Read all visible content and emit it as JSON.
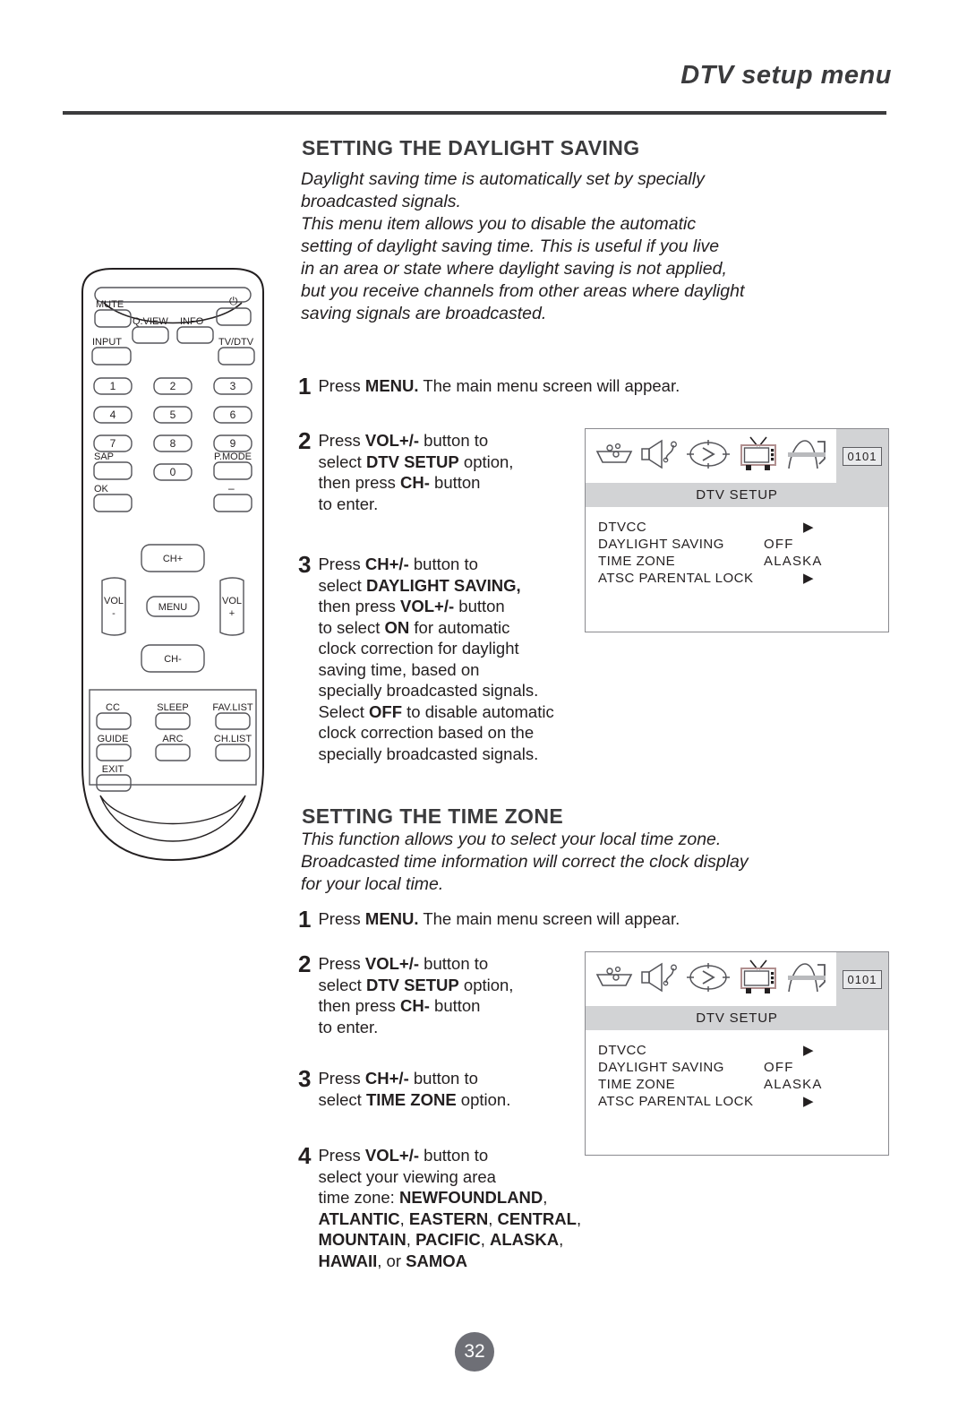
{
  "header": {
    "title": "DTV setup menu"
  },
  "sections": [
    {
      "title": "SETTING THE DAYLIGHT SAVING",
      "body": "Daylight saving time is automatically set by specially\nbroadcasted signals.\nThis menu item allows you to disable the automatic\nsetting of daylight saving time. This is useful if you live\nin an area or state where daylight saving is not applied,\nbut you receive channels from other areas where daylight\nsaving signals are broadcasted."
    },
    {
      "title": "SETTING THE TIME ZONE",
      "body": "This function allows you to select your local time zone.\nBroadcasted time information will correct the clock display\nfor your local time."
    }
  ],
  "steps_daylight": [
    {
      "num": "1",
      "html": "Press <b>MENU.</b> The main menu screen will appear."
    },
    {
      "num": "2",
      "html": "Press <b>VOL+/-</b> button to\nselect <b>DTV SETUP</b> option,\nthen press <b>CH-</b> button\nto enter."
    },
    {
      "num": "3",
      "html": "Press <b>CH+/-</b> button to\nselect <b>DAYLIGHT SAVING,</b>\nthen press <b>VOL+/-</b> button\nto select <b>ON</b> for automatic\nclock correction for daylight\nsaving time, based on\nspecially broadcasted signals.\nSelect <b>OFF</b> to disable automatic\nclock correction based on the\nspecially broadcasted signals."
    }
  ],
  "steps_timezone": [
    {
      "num": "1",
      "html": "Press <b>MENU.</b> The main menu screen will appear."
    },
    {
      "num": "2",
      "html": "Press <b>VOL+/-</b> button to\nselect <b>DTV SETUP</b> option,\nthen press <b>CH-</b> button\nto enter."
    },
    {
      "num": "3",
      "html": "Press <b>CH+/-</b> button to\nselect <b>TIME ZONE</b> option."
    },
    {
      "num": "4",
      "html": "Press <b>VOL+/-</b> button to\nselect your viewing area\ntime zone: <b>NEWFOUNDLAND</b>,\n<b>ATLANTIC</b>, <b>EASTERN</b>, <b>CENTRAL</b>,\n<b>MOUNTAIN</b>, <b>PACIFIC</b>, <b>ALASKA</b>,\n<b>HAWAII</b>, or <b>SAMOA</b>"
    }
  ],
  "osd": {
    "channel_number": "0101",
    "menu_title": "DTV SETUP",
    "icons": [
      "picture-icon",
      "sound-icon",
      "timer-icon",
      "tv-setup-icon",
      "lock-icon"
    ],
    "rows": [
      {
        "label": "DTVCC",
        "value": "",
        "arrow": "▶"
      },
      {
        "label": "DAYLIGHT SAVING",
        "value": "OFF",
        "arrow": ""
      },
      {
        "label": "TIME ZONE",
        "value": "ALASKA",
        "arrow": ""
      },
      {
        "label": "ATSC PARENTAL LOCK",
        "value": "",
        "arrow": "▶"
      }
    ]
  },
  "remote": {
    "top_row": [
      {
        "label": "MUTE",
        "name": "mute-button"
      },
      {
        "label": "Q.VIEW",
        "name": "qview-button"
      },
      {
        "label": "INFO",
        "name": "info-button"
      },
      {
        "label": "⏻",
        "name": "power-button"
      }
    ],
    "second_row": [
      {
        "label": "INPUT",
        "name": "input-button"
      },
      {
        "label": "TV/DTV",
        "name": "tv-dtv-button"
      }
    ],
    "numeric": [
      {
        "label": "1",
        "name": "digit-1-button"
      },
      {
        "label": "2",
        "name": "digit-2-button"
      },
      {
        "label": "3",
        "name": "digit-3-button"
      },
      {
        "label": "4",
        "name": "digit-4-button"
      },
      {
        "label": "5",
        "name": "digit-5-button"
      },
      {
        "label": "6",
        "name": "digit-6-button"
      },
      {
        "label": "7",
        "name": "digit-7-button"
      },
      {
        "label": "8",
        "name": "digit-8-button"
      },
      {
        "label": "9",
        "name": "digit-9-button"
      },
      {
        "label": "0",
        "name": "digit-0-button"
      }
    ],
    "sap_label": "SAP",
    "pmode_label": "P.MODE",
    "ok_label": "OK",
    "dash_label": "–",
    "nav": {
      "ch_up": "CH+",
      "ch_down": "CH-",
      "menu": "MENU",
      "vol_down_top": "VOL",
      "vol_down_bottom": "-",
      "vol_up_top": "VOL",
      "vol_up_bottom": "+"
    },
    "bottom_panel": [
      {
        "label": "CC",
        "name": "cc-button"
      },
      {
        "label": "SLEEP",
        "name": "sleep-button"
      },
      {
        "label": "FAV.LIST",
        "name": "fav-list-button"
      },
      {
        "label": "GUIDE",
        "name": "guide-button"
      },
      {
        "label": "ARC",
        "name": "arc-button"
      },
      {
        "label": "CH.LIST",
        "name": "ch-list-button"
      },
      {
        "label": "EXIT",
        "name": "exit-button"
      }
    ]
  },
  "page_number": "32"
}
